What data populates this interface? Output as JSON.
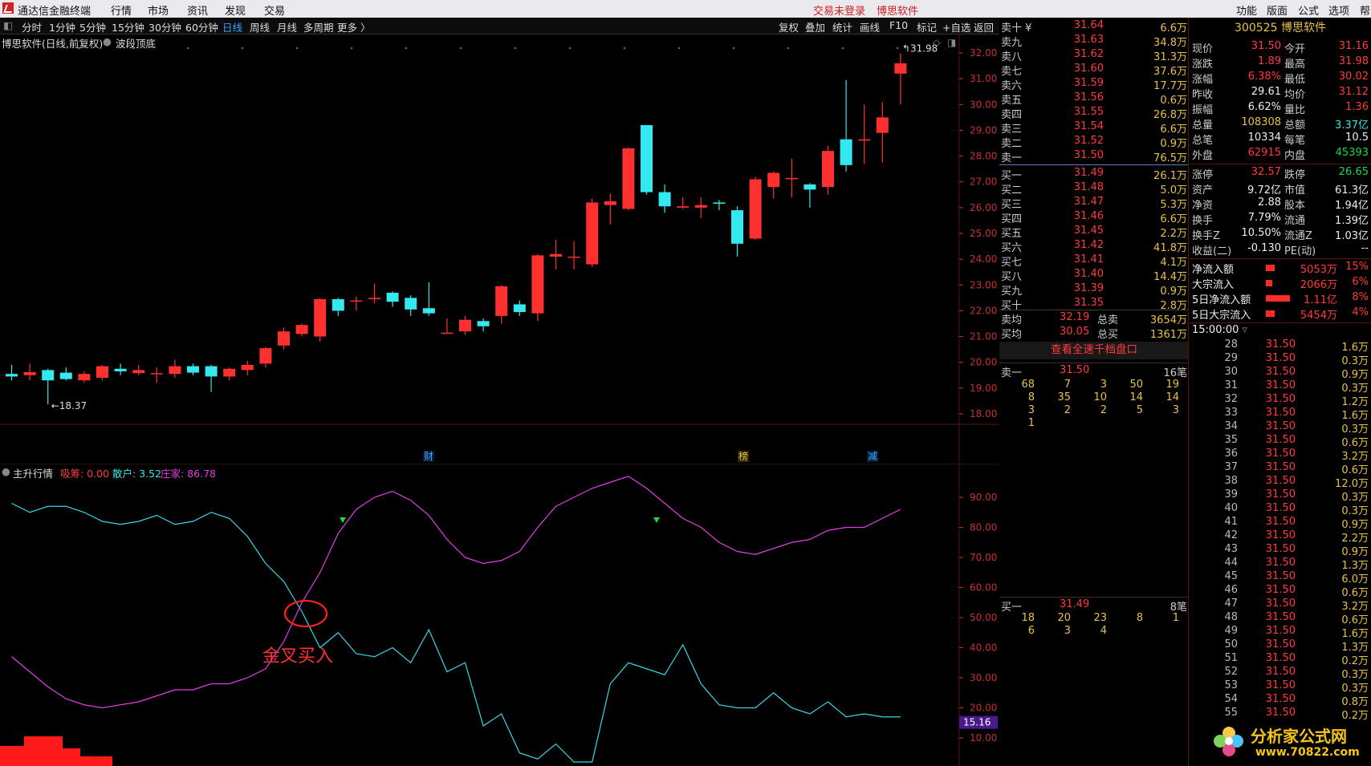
{
  "app": {
    "title": "通达信金融终端",
    "menu": [
      "行情",
      "市场",
      "资讯",
      "发现",
      "交易"
    ],
    "status_left": "交易未登录",
    "status_right": "博思软件",
    "right_menu": [
      "功能",
      "版面",
      "公式",
      "选项",
      "帮"
    ]
  },
  "toolbar": {
    "periods": [
      "分时",
      "1分钟",
      "5分钟",
      "15分钟",
      "30分钟",
      "60分钟",
      "日线",
      "周线",
      "月线",
      "多周期",
      "更多 〉"
    ],
    "active_period": "日线",
    "right_items": [
      "复权",
      "叠加",
      "统计",
      "画线",
      "F10",
      "标记",
      "+自选",
      "返回"
    ]
  },
  "chart": {
    "header": "博思软件(日线,前复权)",
    "indicator_tag": "波段顶底",
    "price_axis": [
      "32.00",
      "31.00",
      "30.00",
      "29.00",
      "28.00",
      "27.00",
      "26.00",
      "25.00",
      "24.00",
      "23.00",
      "22.00",
      "21.00",
      "20.00",
      "19.00",
      "18.00"
    ],
    "low_marker": "18.37",
    "high_marker": "31.98",
    "event_marks": [
      "财",
      "榜",
      "减"
    ],
    "colors": {
      "up": "#ff3030",
      "down": "#33e8ee",
      "bg": "#000000",
      "grid": "#3a0c0c"
    }
  },
  "chart_data": {
    "type": "candlestick",
    "ylim": [
      18.0,
      32.0
    ],
    "candles": [
      {
        "o": 19.55,
        "h": 19.9,
        "l": 19.3,
        "c": 19.45
      },
      {
        "o": 19.5,
        "h": 19.95,
        "l": 19.3,
        "c": 19.62
      },
      {
        "o": 19.7,
        "h": 19.75,
        "l": 18.37,
        "c": 19.3
      },
      {
        "o": 19.6,
        "h": 19.8,
        "l": 19.3,
        "c": 19.35
      },
      {
        "o": 19.3,
        "h": 19.65,
        "l": 19.2,
        "c": 19.55
      },
      {
        "o": 19.4,
        "h": 19.9,
        "l": 19.3,
        "c": 19.85
      },
      {
        "o": 19.75,
        "h": 19.95,
        "l": 19.5,
        "c": 19.65
      },
      {
        "o": 19.58,
        "h": 19.9,
        "l": 19.5,
        "c": 19.7
      },
      {
        "o": 19.58,
        "h": 19.8,
        "l": 19.2,
        "c": 19.58
      },
      {
        "o": 19.55,
        "h": 20.1,
        "l": 19.4,
        "c": 19.85
      },
      {
        "o": 19.85,
        "h": 19.95,
        "l": 19.5,
        "c": 19.6
      },
      {
        "o": 19.85,
        "h": 19.9,
        "l": 18.85,
        "c": 19.45
      },
      {
        "o": 19.45,
        "h": 19.8,
        "l": 19.3,
        "c": 19.75
      },
      {
        "o": 19.7,
        "h": 20.05,
        "l": 19.5,
        "c": 19.9
      },
      {
        "o": 19.95,
        "h": 20.6,
        "l": 19.8,
        "c": 20.55
      },
      {
        "o": 20.65,
        "h": 21.35,
        "l": 20.5,
        "c": 21.2
      },
      {
        "o": 21.1,
        "h": 21.5,
        "l": 21.0,
        "c": 21.45
      },
      {
        "o": 21.0,
        "h": 22.5,
        "l": 20.8,
        "c": 22.45
      },
      {
        "o": 22.45,
        "h": 22.5,
        "l": 21.8,
        "c": 22.0
      },
      {
        "o": 22.4,
        "h": 22.55,
        "l": 22.0,
        "c": 22.4
      },
      {
        "o": 22.45,
        "h": 23.05,
        "l": 22.3,
        "c": 22.5
      },
      {
        "o": 22.7,
        "h": 22.75,
        "l": 22.15,
        "c": 22.35
      },
      {
        "o": 22.5,
        "h": 22.6,
        "l": 21.8,
        "c": 22.05
      },
      {
        "o": 22.1,
        "h": 23.1,
        "l": 21.8,
        "c": 21.9
      },
      {
        "o": 21.15,
        "h": 21.7,
        "l": 21.1,
        "c": 21.15
      },
      {
        "o": 21.2,
        "h": 21.8,
        "l": 21.05,
        "c": 21.65
      },
      {
        "o": 21.6,
        "h": 21.7,
        "l": 21.2,
        "c": 21.4
      },
      {
        "o": 21.8,
        "h": 23.0,
        "l": 21.5,
        "c": 22.95
      },
      {
        "o": 22.25,
        "h": 22.4,
        "l": 21.8,
        "c": 21.95
      },
      {
        "o": 21.9,
        "h": 24.2,
        "l": 21.6,
        "c": 24.15
      },
      {
        "o": 24.1,
        "h": 24.75,
        "l": 23.6,
        "c": 24.2
      },
      {
        "o": 24.1,
        "h": 24.7,
        "l": 23.6,
        "c": 24.1
      },
      {
        "o": 23.8,
        "h": 26.35,
        "l": 23.7,
        "c": 26.2
      },
      {
        "o": 26.1,
        "h": 26.55,
        "l": 25.35,
        "c": 26.25
      },
      {
        "o": 25.95,
        "h": 28.35,
        "l": 25.9,
        "c": 28.3
      },
      {
        "o": 29.2,
        "h": 29.2,
        "l": 26.5,
        "c": 26.6
      },
      {
        "o": 26.6,
        "h": 26.9,
        "l": 25.8,
        "c": 26.05
      },
      {
        "o": 26.0,
        "h": 26.4,
        "l": 25.95,
        "c": 26.05
      },
      {
        "o": 26.0,
        "h": 26.4,
        "l": 25.6,
        "c": 26.1
      },
      {
        "o": 26.2,
        "h": 26.3,
        "l": 25.9,
        "c": 26.15
      },
      {
        "o": 25.9,
        "h": 26.05,
        "l": 24.1,
        "c": 24.6
      },
      {
        "o": 24.8,
        "h": 27.2,
        "l": 24.75,
        "c": 27.1
      },
      {
        "o": 26.8,
        "h": 27.4,
        "l": 26.35,
        "c": 27.35
      },
      {
        "o": 27.1,
        "h": 27.9,
        "l": 26.4,
        "c": 27.15
      },
      {
        "o": 26.9,
        "h": 26.95,
        "l": 26.0,
        "c": 26.7
      },
      {
        "o": 26.8,
        "h": 28.4,
        "l": 26.5,
        "c": 28.2
      },
      {
        "o": 28.65,
        "h": 30.95,
        "l": 27.4,
        "c": 27.65
      },
      {
        "o": 28.6,
        "h": 30.0,
        "l": 27.7,
        "c": 28.65
      },
      {
        "o": 28.9,
        "h": 30.1,
        "l": 27.75,
        "c": 29.5
      },
      {
        "o": 31.2,
        "h": 31.98,
        "l": 30.0,
        "c": 31.6
      }
    ]
  },
  "indicator": {
    "name": "主升行情",
    "params": [
      {
        "label": "吸筹: 0.00",
        "color": "#ff3b3b"
      },
      {
        "label": "散户: 3.52",
        "color": "#38e6e6"
      },
      {
        "label": "庄家: 86.78",
        "color": "#e23fe2"
      }
    ],
    "axis": [
      "90.00",
      "80.00",
      "70.00",
      "60.00",
      "50.00",
      "40.00",
      "30.00",
      "20.00",
      "10.00"
    ],
    "current_tag": "15.16",
    "annotation": "金叉买入",
    "retail_series": [
      88,
      85,
      87,
      87,
      85,
      82,
      81,
      82,
      84,
      81,
      82,
      85,
      83,
      77,
      68,
      62,
      52,
      40,
      45,
      38,
      37,
      40,
      35,
      46,
      32,
      35,
      14,
      18,
      5,
      3,
      8,
      2,
      2,
      28,
      35,
      33,
      31,
      41,
      28,
      21,
      20,
      20,
      25,
      20,
      18,
      22,
      17,
      18,
      17,
      17
    ],
    "dealer_series": [
      37,
      32,
      27,
      23,
      21,
      20,
      21,
      22,
      24,
      26,
      26,
      28,
      28,
      30,
      33,
      42,
      55,
      65,
      78,
      86,
      90,
      92,
      89,
      84,
      76,
      70,
      68,
      69,
      72,
      80,
      87,
      90,
      93,
      95,
      97,
      93,
      88,
      83,
      80,
      75,
      72,
      71,
      73,
      75,
      76,
      79,
      80,
      80,
      83,
      86
    ]
  },
  "orderbook": {
    "sells": [
      {
        "label": "卖十 ¥",
        "price": "31.64",
        "vol": "6.6万"
      },
      {
        "label": "卖九",
        "price": "31.63",
        "vol": "34.8万"
      },
      {
        "label": "卖八",
        "price": "31.62",
        "vol": "31.3万"
      },
      {
        "label": "卖七",
        "price": "31.60",
        "vol": "37.6万"
      },
      {
        "label": "卖六",
        "price": "31.59",
        "vol": "17.7万"
      },
      {
        "label": "卖五",
        "price": "31.56",
        "vol": "0.6万"
      },
      {
        "label": "卖四",
        "price": "31.55",
        "vol": "26.8万"
      },
      {
        "label": "卖三",
        "price": "31.54",
        "vol": "6.6万"
      },
      {
        "label": "卖二",
        "price": "31.52",
        "vol": "0.9万"
      },
      {
        "label": "卖一",
        "price": "31.50",
        "vol": "76.5万"
      }
    ],
    "buys": [
      {
        "label": "买一",
        "price": "31.49",
        "vol": "26.1万"
      },
      {
        "label": "买二",
        "price": "31.48",
        "vol": "5.0万"
      },
      {
        "label": "买三",
        "price": "31.47",
        "vol": "5.3万"
      },
      {
        "label": "买四",
        "price": "31.46",
        "vol": "6.6万"
      },
      {
        "label": "买五",
        "price": "31.45",
        "vol": "2.2万"
      },
      {
        "label": "买六",
        "price": "31.42",
        "vol": "41.8万"
      },
      {
        "label": "买七",
        "price": "31.41",
        "vol": "4.1万"
      },
      {
        "label": "买八",
        "price": "31.40",
        "vol": "14.4万"
      },
      {
        "label": "买九",
        "price": "31.39",
        "vol": "0.9万"
      },
      {
        "label": "买十",
        "price": "31.35",
        "vol": "2.8万"
      }
    ],
    "sell_avg_label": "卖均",
    "sell_avg": "32.19",
    "total_sell_label": "总卖",
    "total_sell": "3654万",
    "buy_avg_label": "买均",
    "buy_avg": "30.05",
    "total_buy_label": "总买",
    "total_buy": "1361万",
    "full_depth_link": "查看全速千档盘口",
    "sell1_queue": {
      "label": "卖一",
      "price": "31.50",
      "count": "16笔",
      "rows": [
        [
          "68",
          "7",
          "3",
          "50",
          "19"
        ],
        [
          "8",
          "35",
          "10",
          "14",
          "14"
        ],
        [
          "3",
          "2",
          "2",
          "5",
          "3"
        ],
        [
          "1",
          "",
          "",
          "",
          ""
        ]
      ]
    },
    "buy1_queue": {
      "label": "买一",
      "price": "31.49",
      "count": "8笔",
      "rows": [
        [
          "18",
          "20",
          "23",
          "8",
          "1"
        ],
        [
          "6",
          "3",
          "4",
          "",
          ""
        ]
      ]
    }
  },
  "quote": {
    "code_name": "300525 博思软件",
    "rows": [
      {
        "l1": "现价",
        "v1": "31.50",
        "c1": "red",
        "l2": "今开",
        "v2": "31.16",
        "c2": "red"
      },
      {
        "l1": "涨跌",
        "v1": "1.89",
        "c1": "red",
        "l2": "最高",
        "v2": "31.98",
        "c2": "red"
      },
      {
        "l1": "涨幅",
        "v1": "6.38%",
        "c1": "red",
        "l2": "最低",
        "v2": "30.02",
        "c2": "red"
      },
      {
        "l1": "昨收",
        "v1": "29.61",
        "c1": "white",
        "l2": "均价",
        "v2": "31.12",
        "c2": "red"
      },
      {
        "l1": "振幅",
        "v1": "6.62%",
        "c1": "white",
        "l2": "量比",
        "v2": "1.36",
        "c2": "red"
      },
      {
        "l1": "总量",
        "v1": "108308",
        "c1": "yellow",
        "l2": "总额",
        "v2": "3.37亿",
        "c2": "cyan"
      },
      {
        "l1": "总笔",
        "v1": "10334",
        "c1": "white",
        "l2": "每笔",
        "v2": "10.5",
        "c2": "white"
      },
      {
        "l1": "外盘",
        "v1": "62915",
        "c1": "red",
        "l2": "内盘",
        "v2": "45393",
        "c2": "green"
      }
    ],
    "rows2": [
      {
        "l1": "涨停",
        "v1": "32.57",
        "c1": "red",
        "l2": "跌停",
        "v2": "26.65",
        "c2": "green"
      },
      {
        "l1": "资产",
        "v1": "9.72亿",
        "c1": "white",
        "l2": "市值",
        "v2": "61.3亿",
        "c2": "white"
      },
      {
        "l1": "净资",
        "v1": "2.88",
        "c1": "white",
        "l2": "股本",
        "v2": "1.94亿",
        "c2": "white"
      },
      {
        "l1": "换手",
        "v1": "7.79%",
        "c1": "white",
        "l2": "流通",
        "v2": "1.39亿",
        "c2": "white"
      },
      {
        "l1": "换手Z",
        "v1": "10.50%",
        "c1": "white",
        "l2": "流通Z",
        "v2": "1.03亿",
        "c2": "white"
      },
      {
        "l1": "收益(二)",
        "v1": "-0.130",
        "c1": "white",
        "l2": "PE(动)",
        "v2": "--",
        "c2": "white"
      }
    ],
    "flows": [
      {
        "label": "净流入额",
        "value": "5053万",
        "pct": "15%",
        "bar": 0.15
      },
      {
        "label": "大宗流入",
        "value": "2066万",
        "pct": "6%",
        "bar": 0.06
      },
      {
        "label": "5日净流入额",
        "value": "1.11亿",
        "pct": "8%",
        "bar": 0.8
      },
      {
        "label": "5日大宗流入",
        "value": "5454万",
        "pct": "4%",
        "bar": 0.15
      }
    ],
    "ticks_header": "15:00:00",
    "ticks": [
      [
        "28",
        "31.50",
        "1.6万"
      ],
      [
        "29",
        "31.50",
        "0.3万"
      ],
      [
        "30",
        "31.50",
        "0.9万"
      ],
      [
        "31",
        "31.50",
        "0.3万"
      ],
      [
        "32",
        "31.50",
        "1.2万"
      ],
      [
        "33",
        "31.50",
        "1.6万"
      ],
      [
        "34",
        "31.50",
        "0.3万"
      ],
      [
        "35",
        "31.50",
        "0.6万"
      ],
      [
        "36",
        "31.50",
        "3.2万"
      ],
      [
        "37",
        "31.50",
        "0.6万"
      ],
      [
        "38",
        "31.50",
        "12.0万"
      ],
      [
        "39",
        "31.50",
        "0.3万"
      ],
      [
        "40",
        "31.50",
        "0.3万"
      ],
      [
        "41",
        "31.50",
        "0.9万"
      ],
      [
        "42",
        "31.50",
        "2.2万"
      ],
      [
        "43",
        "31.50",
        "0.9万"
      ],
      [
        "44",
        "31.50",
        "1.3万"
      ],
      [
        "45",
        "31.50",
        "6.0万"
      ],
      [
        "46",
        "31.50",
        "0.6万"
      ],
      [
        "47",
        "31.50",
        "3.2万"
      ],
      [
        "48",
        "31.50",
        "0.6万"
      ],
      [
        "49",
        "31.50",
        "1.6万"
      ],
      [
        "50",
        "31.50",
        "1.3万"
      ],
      [
        "51",
        "31.50",
        "0.2万"
      ],
      [
        "52",
        "31.50",
        "0.3万"
      ],
      [
        "53",
        "31.50",
        "0.3万"
      ],
      [
        "54",
        "31.50",
        "0.8万"
      ],
      [
        "55",
        "31.50",
        "0.2万"
      ]
    ]
  },
  "watermark": {
    "text": "分析家公式网",
    "url": "www.70822.com"
  }
}
